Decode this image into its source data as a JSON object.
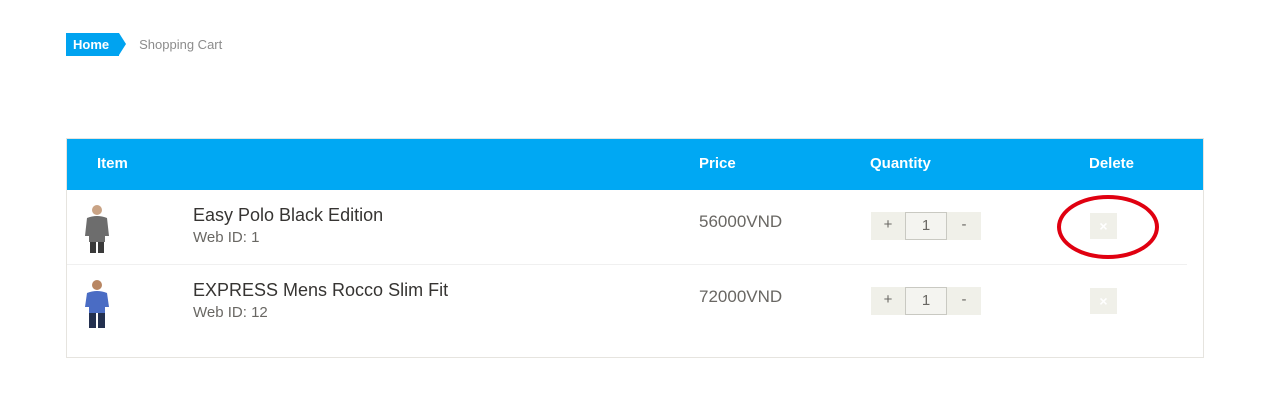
{
  "breadcrumb": {
    "home": "Home",
    "current": "Shopping Cart"
  },
  "table": {
    "headers": {
      "item": "Item",
      "price": "Price",
      "quantity": "Quantity",
      "delete": "Delete"
    },
    "rows": [
      {
        "name": "Easy Polo Black Edition",
        "web_id": "Web ID: 1",
        "price": "56000VND",
        "plus": "+",
        "quantity": "1",
        "minus": "-",
        "delete_icon": "×"
      },
      {
        "name": "EXPRESS Mens Rocco Slim Fit",
        "web_id": "Web ID: 12",
        "price": "72000VND",
        "plus": "+",
        "quantity": "1",
        "minus": "-",
        "delete_icon": "×"
      }
    ]
  },
  "colors": {
    "accent": "#00a8f3",
    "annotation": "#e00010"
  }
}
